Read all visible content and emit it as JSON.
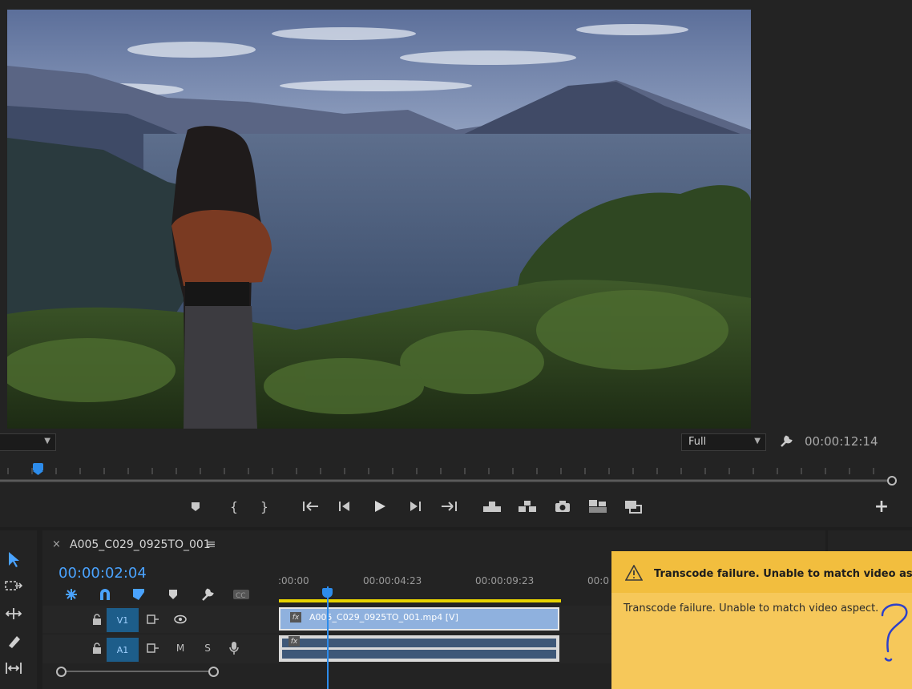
{
  "monitor": {
    "resolution_label": "Full",
    "timecode": "00:00:12:14"
  },
  "transport_icons": [
    "add-marker-icon",
    "mark-in-icon",
    "mark-out-icon",
    "go-to-in-icon",
    "step-back-icon",
    "play-icon",
    "step-forward-icon",
    "go-to-out-icon",
    "lift-icon",
    "extract-icon",
    "export-frame-icon",
    "insert-icon",
    "overwrite-icon"
  ],
  "sequence": {
    "close_label": "×",
    "name": "A005_C029_0925TO_001",
    "menu_glyph": "≡",
    "timecode": "00:00:02:04",
    "ruler_labels": [
      ":00:00",
      "00:00:04:23",
      "00:00:09:23",
      "00:0"
    ],
    "tracks": {
      "video": {
        "label": "V1"
      },
      "audio": {
        "label": "A1",
        "mute": "M",
        "solo": "S"
      }
    },
    "clip_name": "A005_C029_0925TO_001.mp4 [V]",
    "fx_label": "fx"
  },
  "toast": {
    "title": "Transcode failure. Unable to match video aspect.",
    "body": "Transcode failure. Unable to match video aspect.",
    "accent": "#f6c85a"
  }
}
